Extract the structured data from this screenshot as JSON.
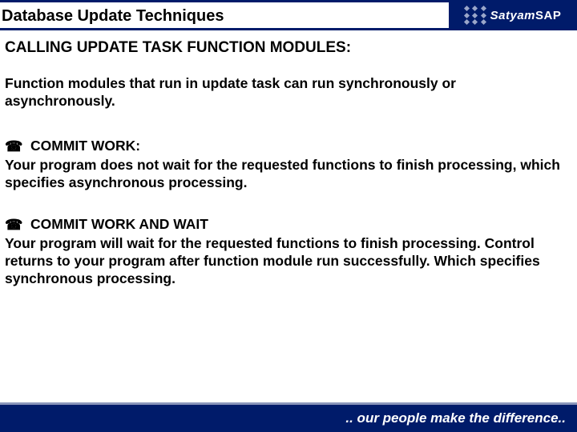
{
  "header": {
    "title": "Database Update Techniques",
    "brand_main": "Satyam",
    "brand_sap": "SAP"
  },
  "content": {
    "subtitle": "CALLING UPDATE TASK FUNCTION MODULES:",
    "intro": "Function modules that run in update task can run synchronously or asynchronously.",
    "bullets": [
      {
        "head": "COMMIT WORK:",
        "body": "Your program does not wait for the requested functions to  finish  processing, which specifies asynchronous processing."
      },
      {
        "head": "COMMIT WORK AND WAIT",
        "body": "Your program will wait  for the requested functions to finish processing. Control returns to your program after function module run successfully. Which specifies synchronous processing."
      }
    ]
  },
  "footer": {
    "tagline": ".. our people make the difference.."
  }
}
